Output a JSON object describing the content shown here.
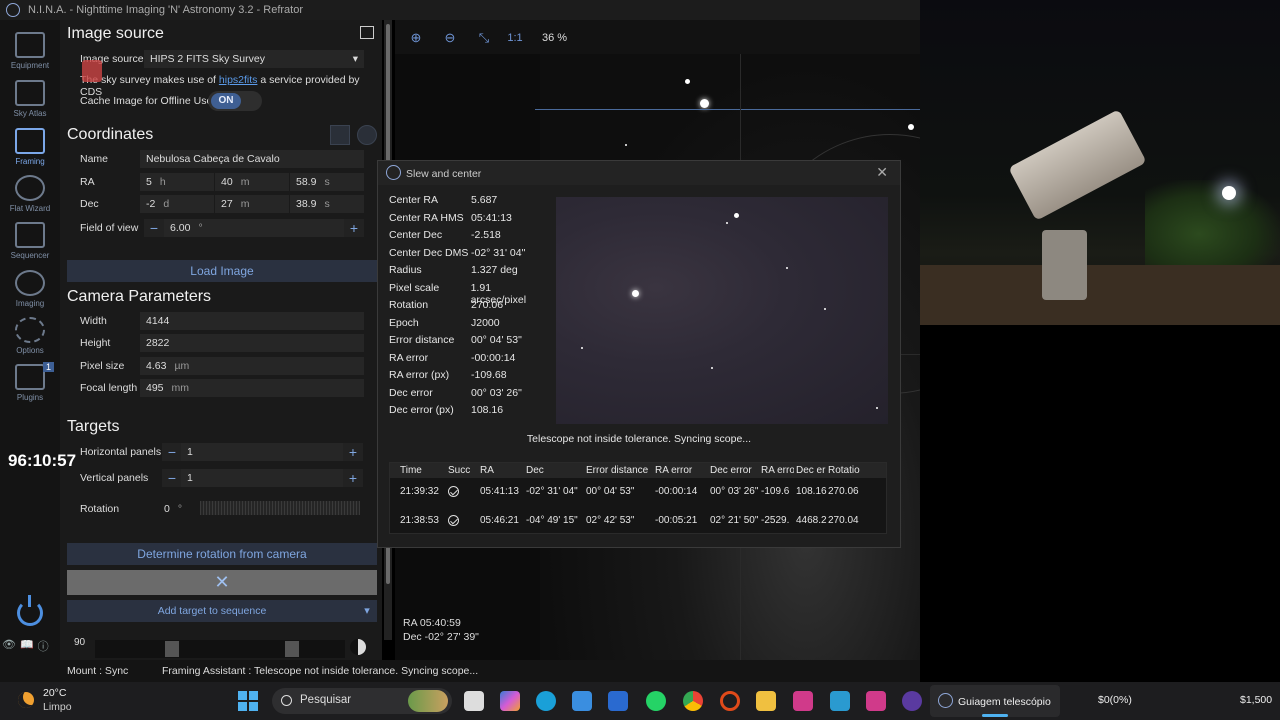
{
  "window": {
    "title": "N.I.N.A. - Nighttime Imaging 'N' Astronomy 3.2  -  Refrator"
  },
  "nav": {
    "items": [
      {
        "label": "Equipment"
      },
      {
        "label": "Sky Atlas"
      },
      {
        "label": "Framing"
      },
      {
        "label": "Flat Wizard"
      },
      {
        "label": "Sequencer"
      },
      {
        "label": "Imaging"
      },
      {
        "label": "Options"
      },
      {
        "label": "Plugins",
        "badge": "1"
      }
    ],
    "collapse": "< <"
  },
  "image_source": {
    "title": "Image source",
    "label": "Image source",
    "value": "HIPS 2 FITS Sky Survey",
    "note_pre": "The sky survey makes use of ",
    "note_link": "hips2fits",
    "note_post": " a service provided by CDS",
    "cache_label": "Cache Image for Offline Use",
    "cache_state": "ON"
  },
  "coordinates": {
    "title": "Coordinates",
    "name_label": "Name",
    "name_value": "Nebulosa Cabeça de Cavalo",
    "ra_label": "RA",
    "ra_h": "5",
    "ra_h_unit": "h",
    "ra_m": "40",
    "ra_m_unit": "m",
    "ra_s": "58.9",
    "ra_s_unit": "s",
    "dec_label": "Dec",
    "dec_d": "-2",
    "dec_d_unit": "d",
    "dec_m": "27",
    "dec_m_unit": "m",
    "dec_s": "38.9",
    "dec_s_unit": "s",
    "fov_label": "Field of view",
    "fov_value": "6.00",
    "fov_unit": "°",
    "load_button": "Load Image"
  },
  "camera": {
    "title": "Camera Parameters",
    "width_label": "Width",
    "width_value": "4144",
    "height_label": "Height",
    "height_value": "2822",
    "pixel_label": "Pixel size",
    "pixel_value": "4.63",
    "pixel_unit": "µm",
    "focal_label": "Focal length",
    "focal_value": "495",
    "focal_unit": "mm"
  },
  "targets": {
    "title": "Targets",
    "hpanels_label": "Horizontal panels",
    "hpanels_value": "1",
    "vpanels_label": "Vertical panels",
    "vpanels_value": "1",
    "rotation_label": "Rotation",
    "rotation_value": "0",
    "rotation_unit": "°",
    "determine_button": "Determine rotation from camera",
    "add_button": "Add target to sequence"
  },
  "bottom_panel": {
    "value": "90"
  },
  "sky": {
    "zoom": "36 %",
    "ratio_button": "1:1",
    "ra_text": "RA  05:40:59",
    "dec_text": "Dec  -02° 27' 39\""
  },
  "dialog": {
    "title": "Slew and center",
    "fields": [
      {
        "k": "Center RA",
        "v": "5.687"
      },
      {
        "k": "Center RA HMS",
        "v": "05:41:13"
      },
      {
        "k": "Center Dec",
        "v": "-2.518"
      },
      {
        "k": "Center Dec DMS",
        "v": "-02° 31' 04\""
      },
      {
        "k": "Radius",
        "v": "1.327 deg"
      },
      {
        "k": "Pixel scale",
        "v": "1.91 arcsec/pixel"
      },
      {
        "k": "Rotation",
        "v": "270.06"
      },
      {
        "k": "Epoch",
        "v": "J2000"
      },
      {
        "k": "Error distance",
        "v": "00° 04' 53\""
      },
      {
        "k": "RA error",
        "v": "-00:00:14"
      },
      {
        "k": "RA error (px)",
        "v": "-109.68"
      },
      {
        "k": "Dec error",
        "v": "00° 03' 26\""
      },
      {
        "k": "Dec error (px)",
        "v": "108.16"
      }
    ],
    "status": "Telescope not inside tolerance. Syncing scope...",
    "history": {
      "headers": [
        "Time",
        "Succ",
        "RA",
        "Dec",
        "Error distance",
        "RA error",
        "Dec error",
        "RA erro",
        "Dec err",
        "Rotatio"
      ],
      "rows": [
        [
          "21:39:32",
          "",
          "05:41:13",
          "-02° 31' 04\"",
          "00° 04' 53\"",
          "-00:00:14",
          "00° 03' 26\"",
          "-109.6",
          "108.16",
          "270.06"
        ],
        [
          "21:38:53",
          "",
          "05:46:21",
          "-04° 49' 15\"",
          "02° 42' 53\"",
          "-00:05:21",
          "02° 21' 50\"",
          "-2529.",
          "4468.2",
          "270.04"
        ]
      ]
    }
  },
  "clock": "96:10:57",
  "statusbar": {
    "mount": "Mount :  Sync",
    "framing": "Framing Assistant :   Telescope not inside tolerance. Syncing scope..."
  },
  "taskbar": {
    "temp": "20°C",
    "weather": "Limpo",
    "search": "Pesquisar",
    "active_task": "Guiagem telescópio",
    "tray1": "$0(0%)",
    "tray2": "$1,500"
  }
}
